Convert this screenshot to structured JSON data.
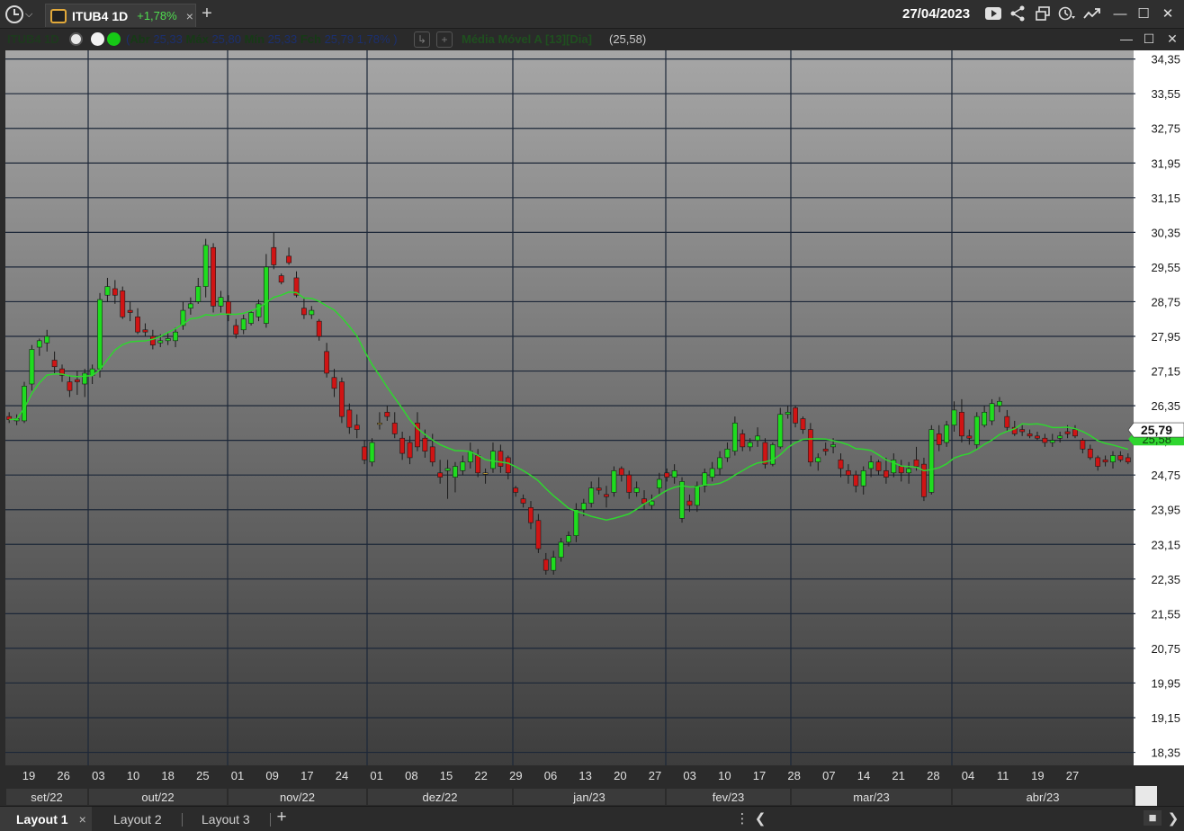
{
  "header": {
    "tab_symbol": "ITUB4 1D",
    "tab_change": "+1,78%",
    "tab_close": "×",
    "add_tab": "+",
    "date": "27/04/2023"
  },
  "infobar": {
    "symbol": "ITUB4 1D",
    "abr_label": "Abr",
    "abr": "25,33",
    "max_label": "Máx",
    "max": "25,80",
    "min_label": "Mín",
    "min": "25,33",
    "fch_label": "Fch",
    "fch": "25,79",
    "pct": "1,78%",
    "ma_label": "Média Móvel A [13][Dia]",
    "ma_value": "(25,58)"
  },
  "bottom": {
    "layouts": [
      "Layout 1",
      "Layout 2",
      "Layout 3"
    ],
    "close": "×",
    "add": "+"
  },
  "colors": {
    "up": "#1fdc1f",
    "down": "#d01414",
    "neutral": "#c8a23a",
    "ma": "#2fd62f",
    "grid": "#1c2738",
    "axis_bg": "#ffffff"
  },
  "chart_data": {
    "type": "candlestick",
    "title": "ITUB4 1D",
    "y_ticks": [
      "34,35",
      "33,55",
      "32,75",
      "31,95",
      "31,15",
      "30,35",
      "29,55",
      "28,75",
      "27,95",
      "27,15",
      "26,35",
      "25,55",
      "24,75",
      "23,95",
      "23,15",
      "22,35",
      "21,55",
      "20,75",
      "19,95",
      "19,15",
      "18,35"
    ],
    "ylim": [
      18.05,
      34.55
    ],
    "x_ticks": [
      "19",
      "26",
      "03",
      "10",
      "18",
      "25",
      "01",
      "09",
      "17",
      "24",
      "01",
      "08",
      "15",
      "22",
      "29",
      "06",
      "13",
      "20",
      "27",
      "03",
      "10",
      "17",
      "28",
      "07",
      "14",
      "21",
      "28",
      "04",
      "11",
      "19",
      "27"
    ],
    "months": [
      "set/22",
      "out/22",
      "nov/22",
      "dez/22",
      "jan/23",
      "fev/23",
      "mar/23",
      "abr/23"
    ],
    "last_price": "25,79",
    "ma_price": "25,58",
    "ma_series_name": "Média Móvel A [13][Dia]",
    "candles": [
      [
        26.1,
        26.2,
        25.95,
        26.03
      ],
      [
        26.0,
        26.15,
        25.9,
        26.05
      ],
      [
        26.0,
        26.9,
        25.95,
        26.8
      ],
      [
        26.85,
        27.75,
        26.7,
        27.65
      ],
      [
        27.7,
        27.9,
        27.5,
        27.85
      ],
      [
        27.8,
        28.1,
        27.6,
        27.95
      ],
      [
        27.4,
        27.6,
        27.1,
        27.25
      ],
      [
        27.2,
        27.3,
        26.9,
        27.05
      ],
      [
        26.9,
        27.05,
        26.55,
        26.7
      ],
      [
        26.95,
        27.15,
        26.6,
        26.9
      ],
      [
        26.85,
        27.2,
        26.55,
        27.1
      ],
      [
        27.05,
        27.3,
        26.85,
        27.2
      ],
      [
        27.2,
        28.95,
        27.0,
        28.8
      ],
      [
        28.9,
        29.3,
        28.75,
        29.1
      ],
      [
        29.05,
        29.25,
        28.7,
        28.9
      ],
      [
        29.0,
        29.1,
        28.35,
        28.4
      ],
      [
        28.55,
        28.75,
        28.3,
        28.5
      ],
      [
        28.4,
        28.6,
        28.0,
        28.05
      ],
      [
        28.1,
        28.25,
        27.95,
        28.05
      ],
      [
        27.95,
        28.1,
        27.65,
        27.75
      ],
      [
        27.8,
        28.0,
        27.7,
        27.85
      ],
      [
        27.85,
        28.05,
        27.75,
        27.9
      ],
      [
        27.85,
        28.15,
        27.7,
        28.05
      ],
      [
        28.2,
        28.75,
        28.1,
        28.55
      ],
      [
        28.6,
        28.85,
        28.45,
        28.7
      ],
      [
        28.75,
        29.3,
        28.7,
        29.1
      ],
      [
        29.1,
        30.2,
        28.85,
        30.05
      ],
      [
        30.0,
        30.1,
        28.5,
        28.65
      ],
      [
        28.65,
        29.0,
        28.5,
        28.85
      ],
      [
        28.75,
        28.9,
        28.3,
        28.45
      ],
      [
        28.2,
        28.35,
        27.9,
        28.0
      ],
      [
        28.1,
        28.45,
        28.0,
        28.35
      ],
      [
        28.25,
        28.55,
        28.2,
        28.5
      ],
      [
        28.4,
        28.8,
        28.3,
        28.7
      ],
      [
        28.25,
        29.85,
        28.15,
        29.55
      ],
      [
        30.0,
        30.35,
        29.5,
        29.6
      ],
      [
        29.35,
        29.4,
        29.15,
        29.2
      ],
      [
        29.8,
        30.0,
        29.6,
        29.65
      ],
      [
        29.3,
        29.45,
        28.85,
        28.9
      ],
      [
        28.6,
        28.85,
        28.35,
        28.45
      ],
      [
        28.45,
        28.65,
        28.35,
        28.55
      ],
      [
        28.3,
        28.35,
        27.85,
        27.95
      ],
      [
        27.6,
        27.8,
        27.0,
        27.1
      ],
      [
        27.0,
        27.2,
        26.55,
        26.75
      ],
      [
        26.9,
        27.0,
        25.95,
        26.1
      ],
      [
        26.25,
        26.4,
        25.7,
        25.85
      ],
      [
        25.9,
        26.15,
        25.6,
        25.8
      ],
      [
        25.4,
        25.55,
        25.0,
        25.1
      ],
      [
        25.05,
        25.6,
        24.95,
        25.5
      ],
      [
        25.95,
        26.2,
        25.8,
        25.95
      ],
      [
        26.2,
        26.35,
        26.0,
        26.1
      ],
      [
        25.95,
        26.2,
        25.6,
        25.7
      ],
      [
        25.6,
        25.75,
        25.1,
        25.25
      ],
      [
        25.5,
        25.65,
        25.0,
        25.15
      ],
      [
        25.95,
        26.2,
        25.3,
        25.4
      ],
      [
        25.6,
        25.8,
        25.15,
        25.3
      ],
      [
        25.4,
        25.7,
        24.95,
        25.05
      ],
      [
        24.8,
        25.1,
        24.55,
        24.7
      ],
      [
        24.85,
        25.1,
        24.2,
        24.9
      ],
      [
        24.7,
        25.05,
        24.35,
        24.95
      ],
      [
        24.85,
        25.2,
        24.75,
        25.05
      ],
      [
        25.05,
        25.5,
        24.9,
        25.3
      ],
      [
        25.2,
        25.35,
        24.7,
        24.8
      ],
      [
        24.8,
        24.9,
        24.55,
        24.8
      ],
      [
        24.9,
        25.5,
        24.8,
        25.3
      ],
      [
        25.3,
        25.45,
        24.8,
        24.95
      ],
      [
        25.15,
        25.2,
        24.65,
        24.8
      ],
      [
        24.45,
        24.5,
        24.25,
        24.35
      ],
      [
        24.2,
        24.3,
        24.0,
        24.1
      ],
      [
        24.0,
        24.15,
        23.5,
        23.65
      ],
      [
        23.7,
        23.85,
        22.95,
        23.05
      ],
      [
        22.8,
        22.95,
        22.45,
        22.55
      ],
      [
        22.55,
        23.0,
        22.45,
        22.85
      ],
      [
        22.85,
        23.3,
        22.75,
        23.2
      ],
      [
        23.2,
        23.45,
        23.1,
        23.35
      ],
      [
        23.35,
        24.1,
        23.2,
        23.95
      ],
      [
        23.95,
        24.2,
        23.8,
        24.1
      ],
      [
        24.1,
        24.6,
        24.0,
        24.45
      ],
      [
        24.45,
        24.7,
        24.3,
        24.4
      ],
      [
        24.3,
        24.5,
        24.0,
        24.25
      ],
      [
        24.35,
        24.95,
        24.25,
        24.85
      ],
      [
        24.9,
        24.95,
        24.6,
        24.75
      ],
      [
        24.75,
        24.85,
        24.2,
        24.35
      ],
      [
        24.35,
        24.6,
        24.25,
        24.45
      ],
      [
        24.2,
        24.4,
        23.95,
        24.1
      ],
      [
        24.05,
        24.3,
        23.95,
        24.15
      ],
      [
        24.45,
        24.8,
        24.3,
        24.65
      ],
      [
        24.8,
        24.9,
        24.6,
        24.7
      ],
      [
        24.7,
        25.0,
        24.55,
        24.85
      ],
      [
        23.75,
        24.7,
        23.65,
        24.6
      ],
      [
        24.15,
        24.3,
        23.9,
        24.05
      ],
      [
        24.05,
        24.6,
        23.9,
        24.5
      ],
      [
        24.5,
        24.9,
        24.35,
        24.8
      ],
      [
        24.7,
        25.05,
        24.6,
        24.9
      ],
      [
        24.9,
        25.3,
        24.75,
        25.15
      ],
      [
        25.15,
        25.5,
        25.05,
        25.35
      ],
      [
        25.3,
        26.1,
        25.2,
        25.95
      ],
      [
        25.7,
        25.8,
        25.3,
        25.4
      ],
      [
        25.4,
        25.6,
        25.3,
        25.5
      ],
      [
        25.55,
        25.85,
        25.4,
        25.65
      ],
      [
        25.5,
        25.6,
        24.9,
        25.0
      ],
      [
        25.0,
        25.5,
        24.95,
        25.45
      ],
      [
        25.4,
        26.3,
        25.35,
        26.15
      ],
      [
        26.15,
        26.35,
        26.05,
        26.2
      ],
      [
        26.3,
        26.35,
        25.85,
        25.95
      ],
      [
        26.05,
        26.1,
        25.7,
        25.8
      ],
      [
        25.8,
        25.95,
        24.95,
        25.05
      ],
      [
        25.05,
        25.25,
        24.85,
        25.15
      ],
      [
        25.35,
        25.5,
        25.2,
        25.3
      ],
      [
        25.4,
        25.6,
        25.25,
        25.45
      ],
      [
        25.1,
        25.25,
        24.7,
        24.9
      ],
      [
        24.85,
        25.0,
        24.55,
        24.75
      ],
      [
        24.75,
        24.85,
        24.35,
        24.5
      ],
      [
        24.5,
        24.95,
        24.3,
        24.85
      ],
      [
        24.9,
        25.2,
        24.7,
        25.05
      ],
      [
        25.05,
        25.1,
        24.75,
        24.85
      ],
      [
        24.85,
        25.15,
        24.55,
        24.7
      ],
      [
        24.8,
        25.25,
        24.7,
        25.1
      ],
      [
        24.95,
        25.1,
        24.6,
        24.8
      ],
      [
        24.8,
        25.05,
        24.55,
        24.9
      ],
      [
        25.1,
        25.4,
        24.85,
        24.95
      ],
      [
        25.0,
        25.15,
        24.15,
        24.25
      ],
      [
        24.35,
        25.9,
        24.3,
        25.8
      ],
      [
        25.7,
        25.9,
        25.3,
        25.45
      ],
      [
        25.5,
        26.0,
        25.4,
        25.9
      ],
      [
        25.9,
        26.45,
        25.75,
        26.25
      ],
      [
        26.2,
        26.5,
        25.5,
        25.65
      ],
      [
        25.65,
        25.8,
        25.45,
        25.6
      ],
      [
        25.45,
        26.2,
        25.35,
        26.1
      ],
      [
        25.9,
        26.35,
        25.85,
        26.2
      ],
      [
        26.0,
        26.5,
        25.9,
        26.4
      ],
      [
        26.35,
        26.55,
        26.2,
        26.45
      ],
      [
        26.1,
        26.25,
        25.75,
        25.85
      ],
      [
        25.85,
        26.0,
        25.65,
        25.7
      ],
      [
        25.8,
        25.9,
        25.65,
        25.75
      ],
      [
        25.7,
        25.8,
        25.6,
        25.65
      ],
      [
        25.65,
        25.75,
        25.55,
        25.6
      ],
      [
        25.6,
        25.7,
        25.4,
        25.5
      ],
      [
        25.5,
        25.7,
        25.4,
        25.55
      ],
      [
        25.6,
        25.75,
        25.5,
        25.65
      ],
      [
        25.75,
        25.9,
        25.6,
        25.7
      ],
      [
        25.8,
        25.9,
        25.6,
        25.65
      ],
      [
        25.55,
        25.6,
        25.25,
        25.35
      ],
      [
        25.35,
        25.45,
        25.1,
        25.15
      ],
      [
        25.15,
        25.2,
        24.85,
        24.95
      ],
      [
        25.1,
        25.2,
        24.95,
        25.05
      ],
      [
        25.05,
        25.3,
        24.9,
        25.2
      ],
      [
        25.2,
        25.3,
        25.05,
        25.1
      ],
      [
        25.15,
        25.25,
        25.0,
        25.05
      ]
    ]
  }
}
